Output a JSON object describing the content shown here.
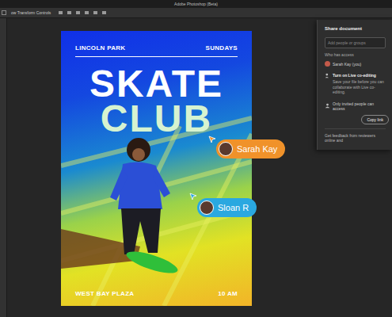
{
  "window": {
    "title": "Adobe Photoshop (Beta)"
  },
  "options_bar": {
    "label": "ow Transform Controls"
  },
  "poster": {
    "top_left": "LINCOLN PARK",
    "top_right": "SUNDAYS",
    "title_lines": [
      "SKATE",
      "CLUB"
    ],
    "bottom_left": "WEST BAY PLAZA",
    "bottom_right": "10 AM"
  },
  "collaborators": [
    {
      "name": "Sarah Kay",
      "color": "#f0922a"
    },
    {
      "name": "Sloan R",
      "color": "#2aa8e0"
    }
  ],
  "share_panel": {
    "title": "Share document",
    "search": {
      "placeholder": "Add people or groups"
    },
    "section": "Who has access",
    "people": [
      "Sarah Kay (you)"
    ],
    "coedit": {
      "title": "Turn on Live co-editing",
      "text": "Save your file before you can collaborate with Live co-editing."
    },
    "access": "Only invited people can access",
    "copy_button": "Copy link",
    "footer": "Get feedback from reviewers online and"
  }
}
